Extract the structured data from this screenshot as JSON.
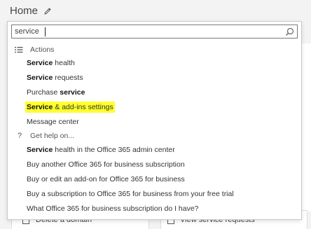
{
  "page": {
    "title": "Home"
  },
  "search": {
    "value": "service",
    "placeholder": ""
  },
  "sections": {
    "actions": "Actions",
    "help": "Get help on..."
  },
  "actions": [
    {
      "bold": "Service",
      "rest": " health",
      "highlight": false
    },
    {
      "bold": "Service",
      "rest": " requests",
      "highlight": false
    },
    {
      "pre": "Purchase ",
      "bold": "service",
      "rest": "",
      "highlight": false
    },
    {
      "bold": "Service",
      "rest": " & add-ins settings",
      "highlight": true
    },
    {
      "bold": "",
      "rest": "Message center",
      "highlight": false
    }
  ],
  "help_items": [
    {
      "bold": "Service",
      "rest": " health in the Office 365 admin center"
    },
    {
      "bold": "",
      "rest": "Buy another Office 365 for business subscription"
    },
    {
      "bold": "",
      "rest": "Buy or edit an add-on for Office 365 for business"
    },
    {
      "bold": "",
      "rest": "Buy a subscription to Office 365 for business from your free trial"
    },
    {
      "bold": "",
      "rest": "What Office 365 for business subscription do I have?"
    }
  ],
  "background": {
    "left_card": "Delete a domain",
    "right_card": "View service requests"
  },
  "colors": {
    "highlight": "#ffff2e",
    "panel_border": "#c9c9c9"
  },
  "icons": {
    "edit": "pencil-icon",
    "search": "search-icon",
    "actions": "list-icon",
    "help": "question-icon"
  }
}
